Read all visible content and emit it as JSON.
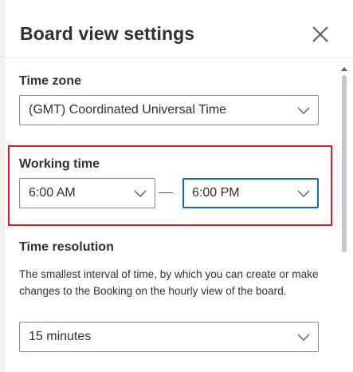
{
  "panel": {
    "title": "Board view settings"
  },
  "time_zone": {
    "label": "Time zone",
    "value": "(GMT) Coordinated Universal Time"
  },
  "working_time": {
    "label": "Working time",
    "start": "6:00 AM",
    "end": "6:00 PM"
  },
  "time_resolution": {
    "label": "Time resolution",
    "description": "The smallest interval of time, by which you can create or make changes to the Booking on the hourly view of the board.",
    "value": "15 minutes"
  },
  "icons": {
    "close": "close-icon",
    "chevron": "chevron-down-icon",
    "scroll_up": "scroll-up-arrow-icon"
  },
  "colors": {
    "focus_border": "#0f6cbd",
    "highlight_border": "#d42026",
    "text": "#323130"
  }
}
